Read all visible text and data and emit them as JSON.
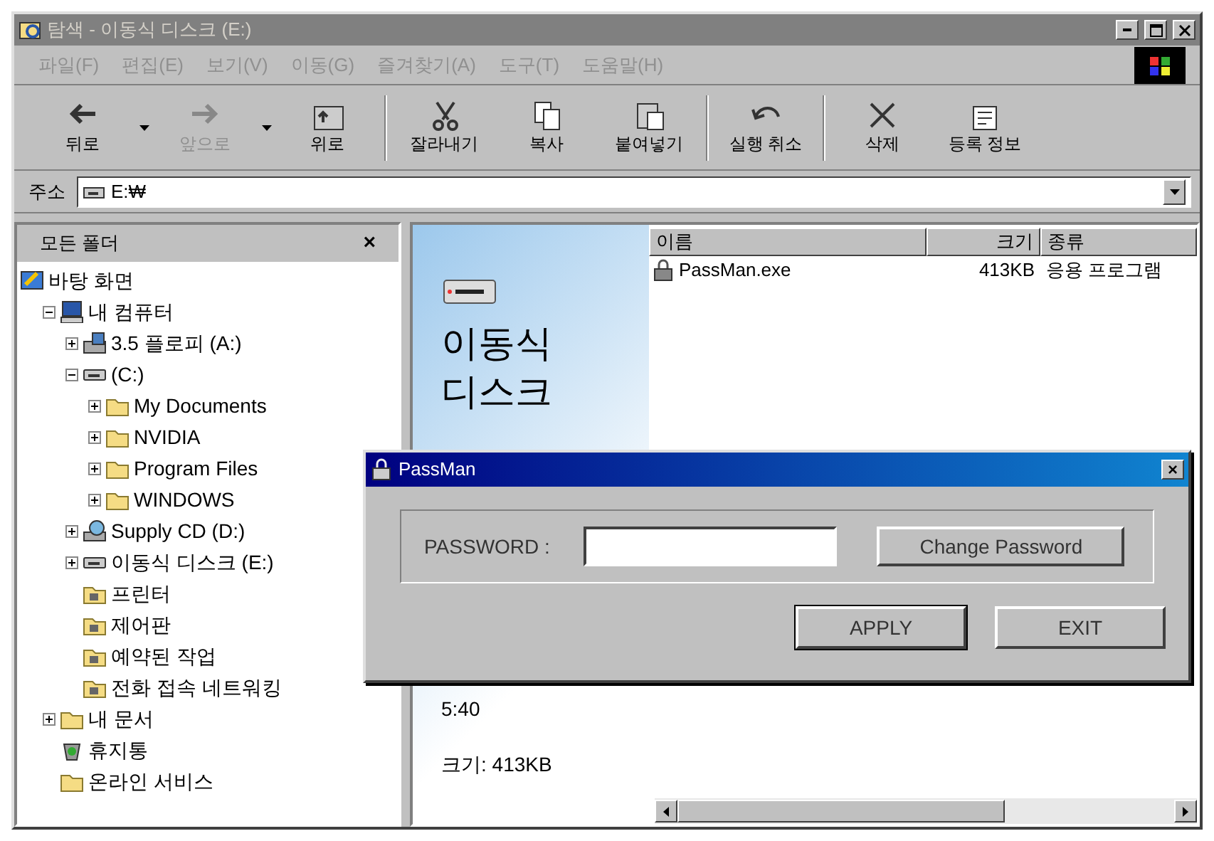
{
  "window": {
    "title": "탐색 - 이동식 디스크 (E:)",
    "active": false
  },
  "menu": [
    "파일(F)",
    "편집(E)",
    "보기(V)",
    "이동(G)",
    "즐겨찾기(A)",
    "도구(T)",
    "도움말(H)"
  ],
  "toolbar": [
    {
      "label": "뒤로",
      "disabled": false,
      "dropdown": true
    },
    {
      "label": "앞으로",
      "disabled": true,
      "dropdown": true
    },
    {
      "label": "위로",
      "disabled": false,
      "dropdown": false
    },
    {
      "label": "잘라내기",
      "disabled": false,
      "dropdown": false
    },
    {
      "label": "복사",
      "disabled": false,
      "dropdown": false
    },
    {
      "label": "붙여넣기",
      "disabled": false,
      "dropdown": false
    },
    {
      "label": "실행 취소",
      "disabled": false,
      "dropdown": false
    },
    {
      "label": "삭제",
      "disabled": false,
      "dropdown": false
    },
    {
      "label": "등록 정보",
      "disabled": false,
      "dropdown": false
    }
  ],
  "address": {
    "label": "주소",
    "value": "E:₩"
  },
  "folders": {
    "title": "모든 폴더",
    "close": "×",
    "tree": [
      {
        "label": "바탕 화면",
        "kind": "desktop",
        "children": [
          {
            "label": "내 컴퓨터",
            "kind": "computer",
            "expanded": true,
            "children": [
              {
                "label": "3.5 플로피 (A:)",
                "kind": "floppy",
                "expanded": false
              },
              {
                "label": "(C:)",
                "kind": "drive",
                "expanded": true,
                "children": [
                  {
                    "label": "My Documents",
                    "kind": "folder",
                    "expanded": false
                  },
                  {
                    "label": "NVIDIA",
                    "kind": "folder",
                    "expanded": false
                  },
                  {
                    "label": "Program Files",
                    "kind": "folder",
                    "expanded": false
                  },
                  {
                    "label": "WINDOWS",
                    "kind": "folder",
                    "expanded": false
                  }
                ]
              },
              {
                "label": "Supply CD (D:)",
                "kind": "cd",
                "expanded": false
              },
              {
                "label": "이동식 디스크 (E:)",
                "kind": "drive",
                "expanded": false
              },
              {
                "label": "프린터",
                "kind": "sysfolder"
              },
              {
                "label": "제어판",
                "kind": "sysfolder"
              },
              {
                "label": "예약된 작업",
                "kind": "sysfolder"
              },
              {
                "label": "전화 접속 네트워킹",
                "kind": "sysfolder"
              }
            ]
          },
          {
            "label": "내 문서",
            "kind": "folder",
            "expanded": false
          },
          {
            "label": "휴지통",
            "kind": "recycle"
          },
          {
            "label": "온라인 서비스",
            "kind": "folder"
          }
        ]
      }
    ]
  },
  "webview": {
    "heading": "이동식 디스크",
    "details": [
      "5:40",
      "크기: 413KB"
    ]
  },
  "files": {
    "columns": [
      "이름",
      "크기",
      "종류"
    ],
    "rows": [
      {
        "name": "PassMan.exe",
        "size": "413KB",
        "type": "응용 프로그램"
      }
    ]
  },
  "dialog": {
    "title": "PassMan",
    "close": "×",
    "password_label": "PASSWORD :",
    "change_button": "Change Password",
    "buttons": [
      {
        "label": "APPLY",
        "default": true
      },
      {
        "label": "EXIT",
        "default": false
      }
    ]
  }
}
